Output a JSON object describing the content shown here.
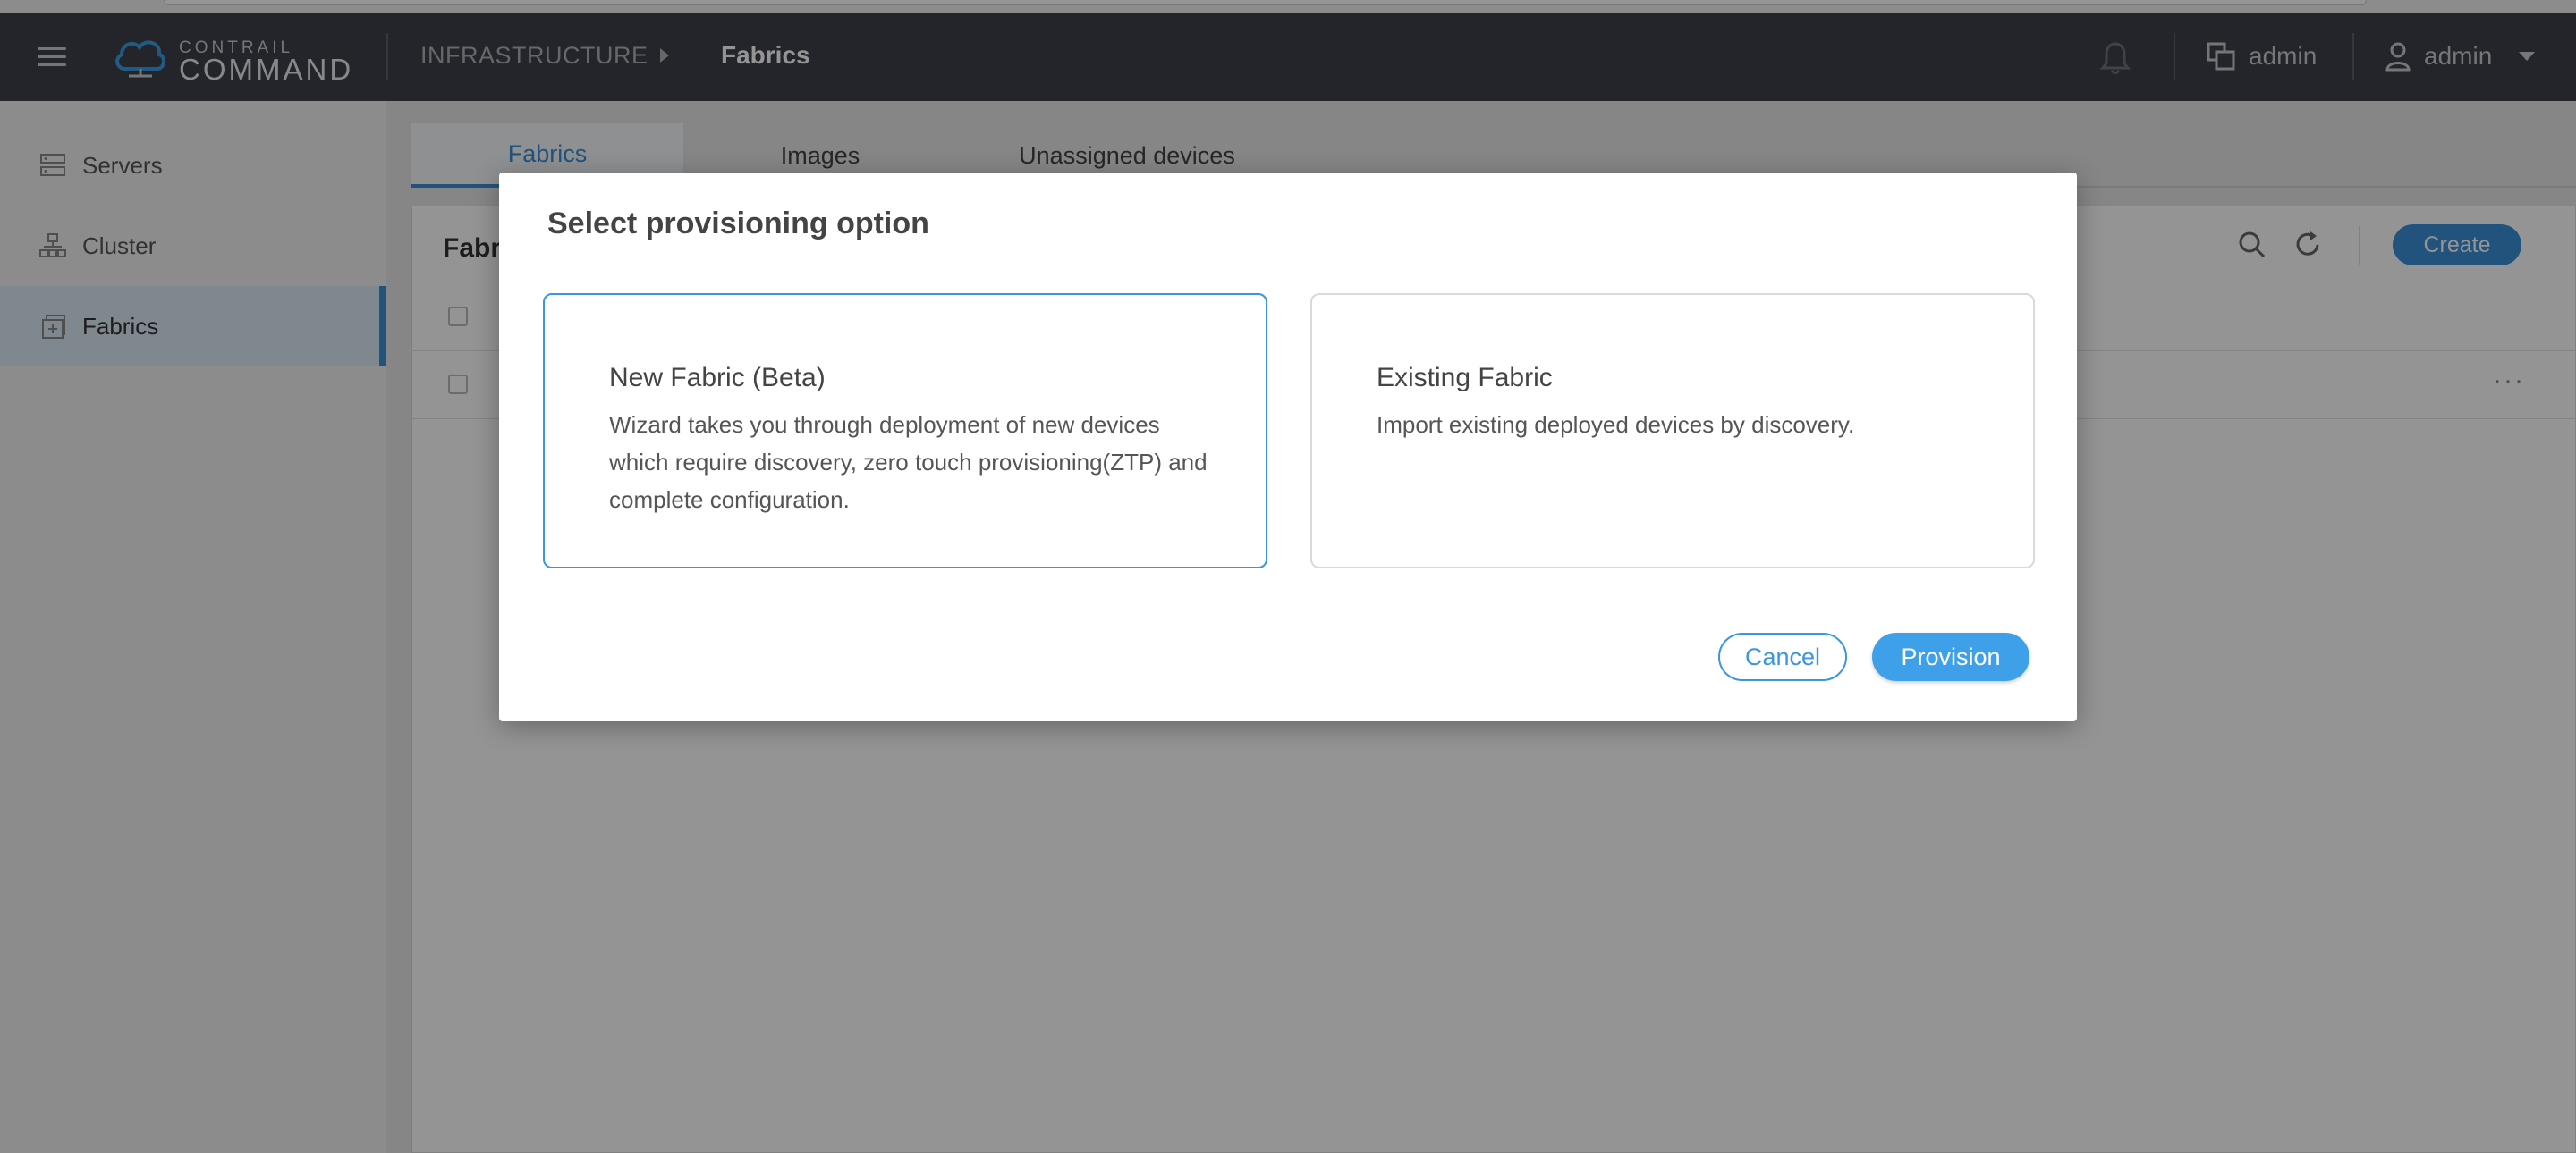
{
  "app": {
    "logo_small": "CONTRAIL",
    "logo_big": "COMMAND",
    "breadcrumb_root": "INFRASTRUCTURE",
    "breadcrumb_current": "Fabrics",
    "tenant_label": "admin",
    "user_label": "admin"
  },
  "sidebar": {
    "items": [
      {
        "label": "Servers",
        "icon": "server-icon"
      },
      {
        "label": "Cluster",
        "icon": "cluster-icon"
      },
      {
        "label": "Fabrics",
        "icon": "fabric-icon"
      }
    ]
  },
  "main": {
    "tabs": [
      {
        "label": "Fabrics",
        "active": true
      },
      {
        "label": "Images",
        "active": false
      },
      {
        "label": "Unassigned devices",
        "active": false
      }
    ],
    "card_title": "Fabr",
    "create_label": "Create",
    "row_more": "···"
  },
  "modal": {
    "title": "Select provisioning option",
    "options": [
      {
        "title": "New Fabric (Beta)",
        "description": "Wizard takes you through deployment of new devices which require discovery, zero touch provisioning(ZTP) and complete configuration.",
        "selected": true
      },
      {
        "title": "Existing Fabric",
        "description": "Import existing deployed devices by discovery.",
        "selected": false
      }
    ],
    "cancel_label": "Cancel",
    "provision_label": "Provision"
  },
  "colors": {
    "header_bg": "#3d4149",
    "accent": "#3a8fd8",
    "primary_button": "#3fa0ea",
    "overlay": "rgba(0,0,0,0.42)"
  }
}
